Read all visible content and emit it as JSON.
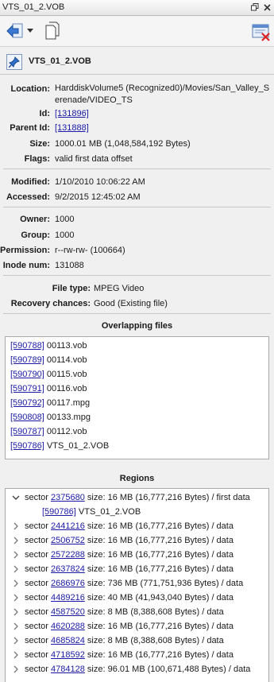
{
  "window": {
    "title": "VTS_01_2.VOB"
  },
  "toolbar": {
    "back_label": "Back",
    "menu_label": "History",
    "copy_label": "Copy",
    "close_label": "Close"
  },
  "file": {
    "name": "VTS_01_2.VOB"
  },
  "properties": {
    "location_label": "Location:",
    "location_value": "HarddiskVolume5 (Recognized0)/Movies/San_Valley_Serenade/VIDEO_TS",
    "id_label": "Id:",
    "id_value": "[131896]",
    "parent_id_label": "Parent Id:",
    "parent_id_value": "[131888]",
    "size_label": "Size:",
    "size_value": "1000.01 MB (1,048,584,192 Bytes)",
    "flags_label": "Flags:",
    "flags_value": "valid first data offset",
    "modified_label": "Modified:",
    "modified_value": "1/10/2010 10:06:22 AM",
    "accessed_label": "Accessed:",
    "accessed_value": "9/2/2015 12:45:02 AM",
    "owner_label": "Owner:",
    "owner_value": "1000",
    "group_label": "Group:",
    "group_value": "1000",
    "permission_label": "Permission:",
    "permission_value": "r--rw-rw- (100664)",
    "inode_label": "Inode num:",
    "inode_value": "131088",
    "filetype_label": "File type:",
    "filetype_value": "MPEG Video",
    "recovery_label": "Recovery chances:",
    "recovery_value": "Good (Existing file)"
  },
  "overlapping": {
    "title": "Overlapping files",
    "items": [
      {
        "id": "[590788]",
        "name": "00113.vob"
      },
      {
        "id": "[590789]",
        "name": "00114.vob"
      },
      {
        "id": "[590790]",
        "name": "00115.vob"
      },
      {
        "id": "[590791]",
        "name": "00116.vob"
      },
      {
        "id": "[590792]",
        "name": "00117.mpg"
      },
      {
        "id": "[590808]",
        "name": "00133.mpg"
      },
      {
        "id": "[590787]",
        "name": "00112.vob"
      },
      {
        "id": "[590786]",
        "name": "VTS_01_2.VOB"
      }
    ]
  },
  "regions": {
    "title": "Regions",
    "sector_word": "sector",
    "items": [
      {
        "sector": "2375680",
        "desc": "size: 16 MB (16,777,216 Bytes) / first data",
        "expanded": true,
        "child_id": "[590786]",
        "child_name": "VTS_01_2.VOB"
      },
      {
        "sector": "2441216",
        "desc": "size: 16 MB (16,777,216 Bytes) / data"
      },
      {
        "sector": "2506752",
        "desc": "size: 16 MB (16,777,216 Bytes) / data"
      },
      {
        "sector": "2572288",
        "desc": "size: 16 MB (16,777,216 Bytes) / data"
      },
      {
        "sector": "2637824",
        "desc": "size: 16 MB (16,777,216 Bytes) / data"
      },
      {
        "sector": "2686976",
        "desc": "size: 736 MB (771,751,936 Bytes) / data"
      },
      {
        "sector": "4489216",
        "desc": "size: 40 MB (41,943,040 Bytes) / data"
      },
      {
        "sector": "4587520",
        "desc": "size: 8 MB (8,388,608 Bytes) / data"
      },
      {
        "sector": "4620288",
        "desc": "size: 16 MB (16,777,216 Bytes) / data"
      },
      {
        "sector": "4685824",
        "desc": "size: 8 MB (8,388,608 Bytes) / data"
      },
      {
        "sector": "4718592",
        "desc": "size: 16 MB (16,777,216 Bytes) / data"
      },
      {
        "sector": "4784128",
        "desc": "size: 96.01 MB (100,671,488 Bytes) / data"
      }
    ]
  }
}
